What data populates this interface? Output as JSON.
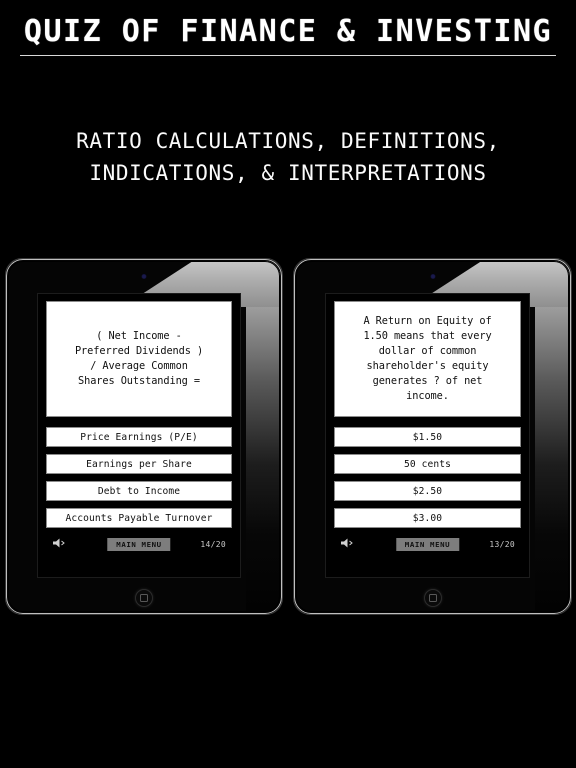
{
  "header": {
    "title": "QUIZ OF FINANCE & INVESTING",
    "subtitle_line1": "RATIO CALCULATIONS, DEFINITIONS,",
    "subtitle_line2": "INDICATIONS, & INTERPRETATIONS"
  },
  "colors": {
    "background": "#000000",
    "text": "#ffffff",
    "card_background": "#ffffff",
    "card_text": "#111111",
    "card_border": "#8c8c8c",
    "menu_button_background": "#7d7d7d",
    "bezel_highlight": "#c9c9c9",
    "camera_dot": "#1a1a4d"
  },
  "tablets": [
    {
      "id": "left",
      "question": "( Net Income -\nPreferred Dividends )\n/ Average Common\nShares Outstanding =",
      "answers": [
        "Price Earnings (P/E)",
        "Earnings per Share",
        "Debt to Income",
        "Accounts Payable Turnover"
      ],
      "footer": {
        "sound_icon": "speaker-muted-icon",
        "menu_label": "MAIN MENU",
        "counter": "14/20"
      }
    },
    {
      "id": "right",
      "question": "A Return on Equity of\n1.50 means that every\ndollar of common\nshareholder's equity\ngenerates ? of net\nincome.",
      "answers": [
        "$1.50",
        "50 cents",
        "$2.50",
        "$3.00"
      ],
      "footer": {
        "sound_icon": "speaker-muted-icon",
        "menu_label": "MAIN MENU",
        "counter": "13/20"
      }
    }
  ]
}
